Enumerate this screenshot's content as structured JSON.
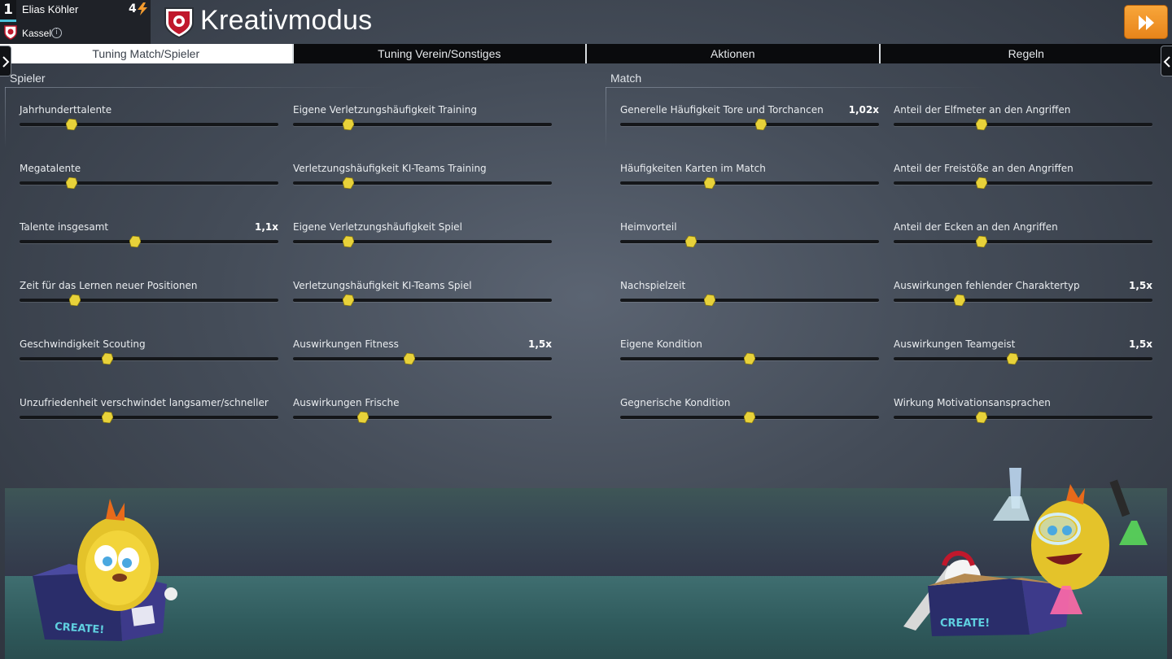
{
  "header": {
    "rank": "1",
    "manager_name": "Elias Köhler",
    "points": "4",
    "club_name": "Kassel",
    "title": "Kreativmodus"
  },
  "tabs": [
    {
      "label": "Tuning Match/Spieler",
      "active": true
    },
    {
      "label": "Tuning Verein/Sonstiges",
      "active": false
    },
    {
      "label": "Aktionen",
      "active": false
    },
    {
      "label": "Regeln",
      "active": false
    }
  ],
  "sections": {
    "left_title": "Spieler",
    "right_title": "Match"
  },
  "settings": [
    {
      "label": "Jahrhunderttalente",
      "value": "",
      "level": 0.2
    },
    {
      "label": "Eigene Verletzungshäufigkeit Training",
      "value": "",
      "level": 0.215
    },
    {
      "label": "Generelle Häufigkeit Tore und Torchancen",
      "value": "1,02x",
      "level": 0.545
    },
    {
      "label": "Anteil der Elfmeter an den Angriffen",
      "value": "",
      "level": 0.34
    },
    {
      "label": "Megatalente",
      "value": "",
      "level": 0.2
    },
    {
      "label": "Verletzungshäufigkeit KI-Teams Training",
      "value": "",
      "level": 0.215
    },
    {
      "label": "Häufigkeiten Karten im Match",
      "value": "",
      "level": 0.345
    },
    {
      "label": "Anteil der Freistöße an den Angriffen",
      "value": "",
      "level": 0.34
    },
    {
      "label": "Talente insgesamt",
      "value": "1,1x",
      "level": 0.445
    },
    {
      "label": "Eigene Verletzungshäufigkeit Spiel",
      "value": "",
      "level": 0.215
    },
    {
      "label": "Heimvorteil",
      "value": "",
      "level": 0.275
    },
    {
      "label": "Anteil der Ecken an den Angriffen",
      "value": "",
      "level": 0.34
    },
    {
      "label": "Zeit für das Lernen neuer Positionen",
      "value": "",
      "level": 0.215
    },
    {
      "label": "Verletzungshäufigkeit KI-Teams Spiel",
      "value": "",
      "level": 0.215
    },
    {
      "label": "Nachspielzeit",
      "value": "",
      "level": 0.345
    },
    {
      "label": "Auswirkungen fehlender Charaktertyp",
      "value": "1,5x",
      "level": 0.255
    },
    {
      "label": "Geschwindigkeit Scouting",
      "value": "",
      "level": 0.34
    },
    {
      "label": "Auswirkungen Fitness",
      "value": "1,5x",
      "level": 0.45
    },
    {
      "label": "Eigene Kondition",
      "value": "",
      "level": 0.5
    },
    {
      "label": "Auswirkungen Teamgeist",
      "value": "1,5x",
      "level": 0.46
    },
    {
      "label": "Unzufriedenheit verschwindet langsamer/schneller",
      "value": "",
      "level": 0.34
    },
    {
      "label": "Auswirkungen Frische",
      "value": "",
      "level": 0.27
    },
    {
      "label": "Gegnerische Kondition",
      "value": "",
      "level": 0.5
    },
    {
      "label": "Wirkung Motivationsansprachen",
      "value": "",
      "level": 0.34
    }
  ],
  "mascots": {
    "left_box_text": "CREATE!",
    "right_box_text": "CREATE!"
  },
  "colors": {
    "accent_orange": "#f29a2e",
    "knob_yellow": "#e8d23a",
    "rank_bar": "#49c0d8"
  },
  "icons": {
    "continue": "fast-forward-icon",
    "club": "club-crest-icon",
    "points": "lightning-bolt-icon",
    "info": "info-icon"
  }
}
